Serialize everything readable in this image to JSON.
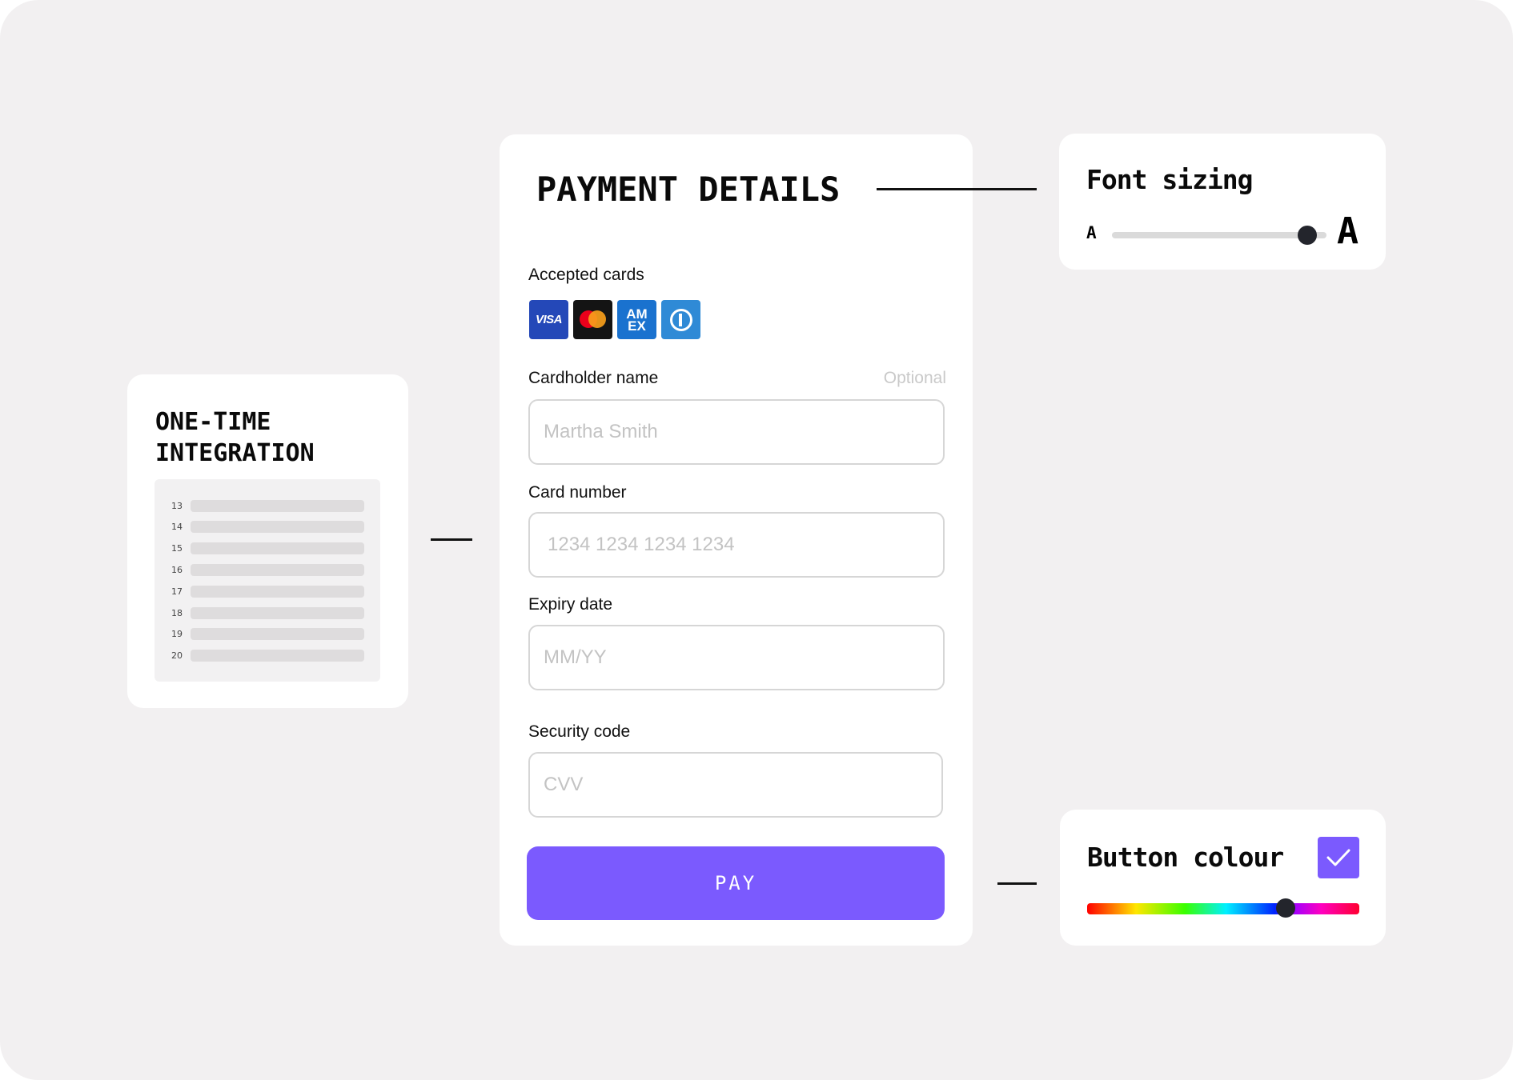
{
  "payment": {
    "title": "PAYMENT DETAILS",
    "accepted_cards_label": "Accepted cards",
    "cards": [
      {
        "name": "visa-icon",
        "label": "VISA"
      },
      {
        "name": "mastercard-icon",
        "label": ""
      },
      {
        "name": "amex-icon",
        "label": "AM EX"
      },
      {
        "name": "diners-club-icon",
        "label": ""
      }
    ],
    "fields": {
      "cardholder": {
        "label": "Cardholder name",
        "hint": "Optional",
        "placeholder": "Martha Smith",
        "value": ""
      },
      "card_number": {
        "label": "Card number",
        "placeholder": "1234 1234 1234 1234",
        "value": ""
      },
      "expiry": {
        "label": "Expiry date",
        "placeholder": "MM/YY",
        "value": ""
      },
      "security": {
        "label": "Security code",
        "placeholder": "CVV",
        "value": ""
      }
    },
    "pay_button_label": "PAY",
    "accent_color": "#7b5afe"
  },
  "integration": {
    "title_line1": "ONE-TIME",
    "title_line2": "INTEGRATION",
    "line_numbers": [
      "13",
      "14",
      "15",
      "16",
      "17",
      "18",
      "19",
      "20"
    ]
  },
  "font_sizing": {
    "title": "Font sizing",
    "small_label": "A",
    "large_label": "A",
    "slider_value_percent": 91
  },
  "button_colour": {
    "title": "Button colour",
    "checked": true,
    "hue_slider_value_percent": 73,
    "selected_color": "#7b5afe"
  }
}
